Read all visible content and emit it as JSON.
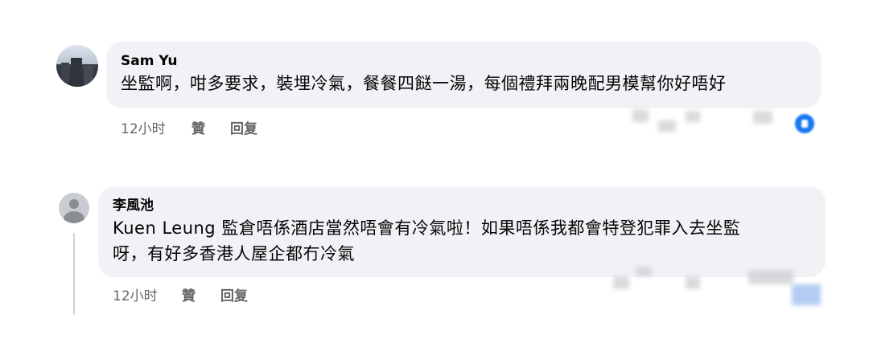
{
  "comments": [
    {
      "author": "Sam Yu",
      "text": "坐監啊，咁多要求，裝埋冷氣，餐餐四餸一湯，每個禮拜兩晚配男模幫你好唔好",
      "time": "12小时",
      "like_label": "贊",
      "reply_label": "回复"
    },
    {
      "author": "李風池",
      "tag": "Kuen Leung",
      "text_line1": " 監倉唔係酒店當然唔會有冷氣啦！如果唔係我都會特登犯罪入去坐監",
      "text_line2": "呀，有好多香港人屋企都冇冷氣",
      "time": "12小时",
      "like_label": "贊",
      "reply_label": "回复"
    }
  ],
  "colors": {
    "bubble_bg": "#f0f2f5",
    "text": "#050505",
    "meta": "#65676b",
    "reaction_blue": "#1877f2"
  },
  "icons": [
    "user-photo-avatar",
    "default-user-avatar",
    "like-reaction-icon"
  ]
}
